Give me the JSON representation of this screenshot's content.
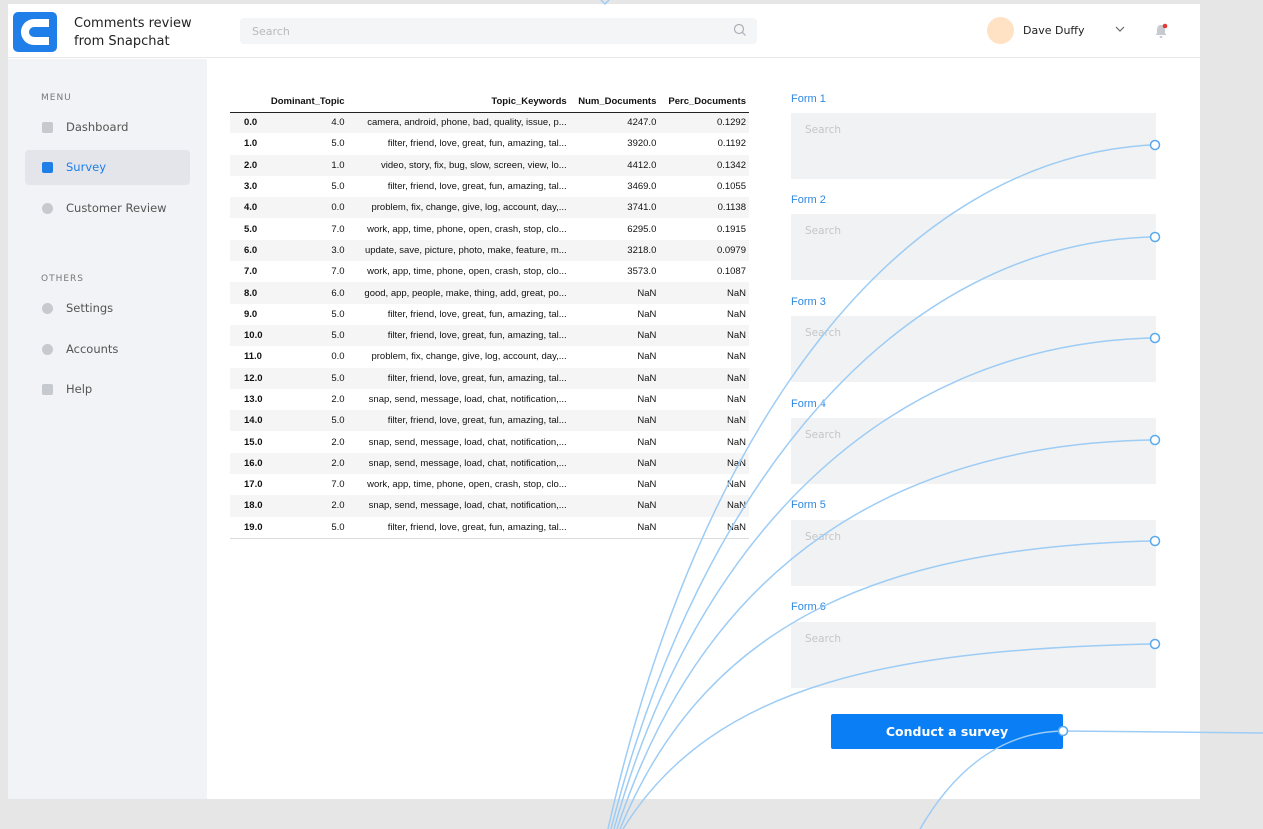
{
  "header": {
    "app_title": "Comments review from Snapchat",
    "search_placeholder": "Search",
    "user_name": "Dave Duffy"
  },
  "sidebar": {
    "menu_heading": "MENU",
    "menu_items": [
      {
        "label": "Dashboard",
        "icon": "chart-icon",
        "active": false
      },
      {
        "label": "Survey",
        "icon": "document-icon",
        "active": true
      },
      {
        "label": "Customer Review",
        "icon": "chat-icon",
        "active": false
      }
    ],
    "others_heading": "OTHERS",
    "other_items": [
      {
        "label": "Settings",
        "icon": "gear-icon"
      },
      {
        "label": "Accounts",
        "icon": "user-icon"
      },
      {
        "label": "Help",
        "icon": "info-icon"
      }
    ]
  },
  "table": {
    "columns": [
      "",
      "Dominant_Topic",
      "Topic_Keywords",
      "Num_Documents",
      "Perc_Documents"
    ],
    "rows": [
      [
        "0.0",
        "4.0",
        "camera, android, phone, bad, quality, issue, p...",
        "4247.0",
        "0.1292"
      ],
      [
        "1.0",
        "5.0",
        "filter, friend, love, great, fun, amazing, tal...",
        "3920.0",
        "0.1192"
      ],
      [
        "2.0",
        "1.0",
        "video, story, fix, bug, slow, screen, view, lo...",
        "4412.0",
        "0.1342"
      ],
      [
        "3.0",
        "5.0",
        "filter, friend, love, great, fun, amazing, tal...",
        "3469.0",
        "0.1055"
      ],
      [
        "4.0",
        "0.0",
        "problem, fix, change, give, log, account, day,...",
        "3741.0",
        "0.1138"
      ],
      [
        "5.0",
        "7.0",
        "work, app, time, phone, open, crash, stop, clo...",
        "6295.0",
        "0.1915"
      ],
      [
        "6.0",
        "3.0",
        "update, save, picture, photo, make, feature, m...",
        "3218.0",
        "0.0979"
      ],
      [
        "7.0",
        "7.0",
        "work, app, time, phone, open, crash, stop, clo...",
        "3573.0",
        "0.1087"
      ],
      [
        "8.0",
        "6.0",
        "good, app, people, make, thing, add, great, po...",
        "NaN",
        "NaN"
      ],
      [
        "9.0",
        "5.0",
        "filter, friend, love, great, fun, amazing, tal...",
        "NaN",
        "NaN"
      ],
      [
        "10.0",
        "5.0",
        "filter, friend, love, great, fun, amazing, tal...",
        "NaN",
        "NaN"
      ],
      [
        "11.0",
        "0.0",
        "problem, fix, change, give, log, account, day,...",
        "NaN",
        "NaN"
      ],
      [
        "12.0",
        "5.0",
        "filter, friend, love, great, fun, amazing, tal...",
        "NaN",
        "NaN"
      ],
      [
        "13.0",
        "2.0",
        "snap, send, message, load, chat, notification,...",
        "NaN",
        "NaN"
      ],
      [
        "14.0",
        "5.0",
        "filter, friend, love, great, fun, amazing, tal...",
        "NaN",
        "NaN"
      ],
      [
        "15.0",
        "2.0",
        "snap, send, message, load, chat, notification,...",
        "NaN",
        "NaN"
      ],
      [
        "16.0",
        "2.0",
        "snap, send, message, load, chat, notification,...",
        "NaN",
        "NaN"
      ],
      [
        "17.0",
        "7.0",
        "work, app, time, phone, open, crash, stop, clo...",
        "NaN",
        "NaN"
      ],
      [
        "18.0",
        "2.0",
        "snap, send, message, load, chat, notification,...",
        "NaN",
        "NaN"
      ],
      [
        "19.0",
        "5.0",
        "filter, friend, love, great, fun, amazing, tal...",
        "NaN",
        "NaN"
      ]
    ]
  },
  "forms": [
    {
      "label": "Form 1",
      "placeholder": "Search"
    },
    {
      "label": "Form 2",
      "placeholder": "Search"
    },
    {
      "label": "Form 3",
      "placeholder": "Search"
    },
    {
      "label": "Form 4",
      "placeholder": "Search"
    },
    {
      "label": "Form 5",
      "placeholder": "Search"
    },
    {
      "label": "Form 6",
      "placeholder": "Search"
    }
  ],
  "survey_button_label": "Conduct a survey",
  "colors": {
    "accent": "#1f7ee8",
    "button": "#0a7ff5",
    "connector": "#9dccf5",
    "notification_dot": "#e53935"
  }
}
